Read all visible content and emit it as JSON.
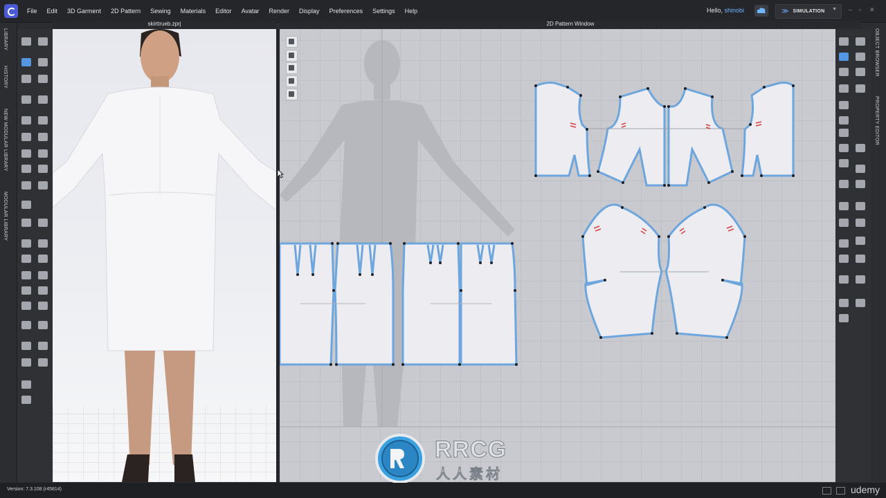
{
  "app": {
    "title_3d": "skirttrueb.zprj",
    "title_2d": "2D Pattern Window"
  },
  "menu": [
    "File",
    "Edit",
    "3D Garment",
    "2D Pattern",
    "Sewing",
    "Materials",
    "Editor",
    "Avatar",
    "Render",
    "Display",
    "Preferences",
    "Settings",
    "Help"
  ],
  "user": {
    "greeting": "Hello,",
    "name": "shinobi"
  },
  "mode": {
    "label": "SIMULATION"
  },
  "left_tabs": [
    "LIBRARY",
    "HISTORY",
    "NEW MODULAR LIBRARY",
    "MODULAR LIBRARY"
  ],
  "right_tabs": [
    "OBJECT BROWSER",
    "PROPERTY EDITOR"
  ],
  "status": {
    "version": "Version: 7.3.108 (r45814)",
    "brand": "udemy"
  },
  "watermark": {
    "title": "RRCG",
    "subtitle": "人人素材"
  },
  "colors": {
    "accent": "#4c5bd4",
    "link": "#6fb6ff",
    "pattern_outline": "#6da5dd",
    "pattern_fill": "#ececf1"
  }
}
